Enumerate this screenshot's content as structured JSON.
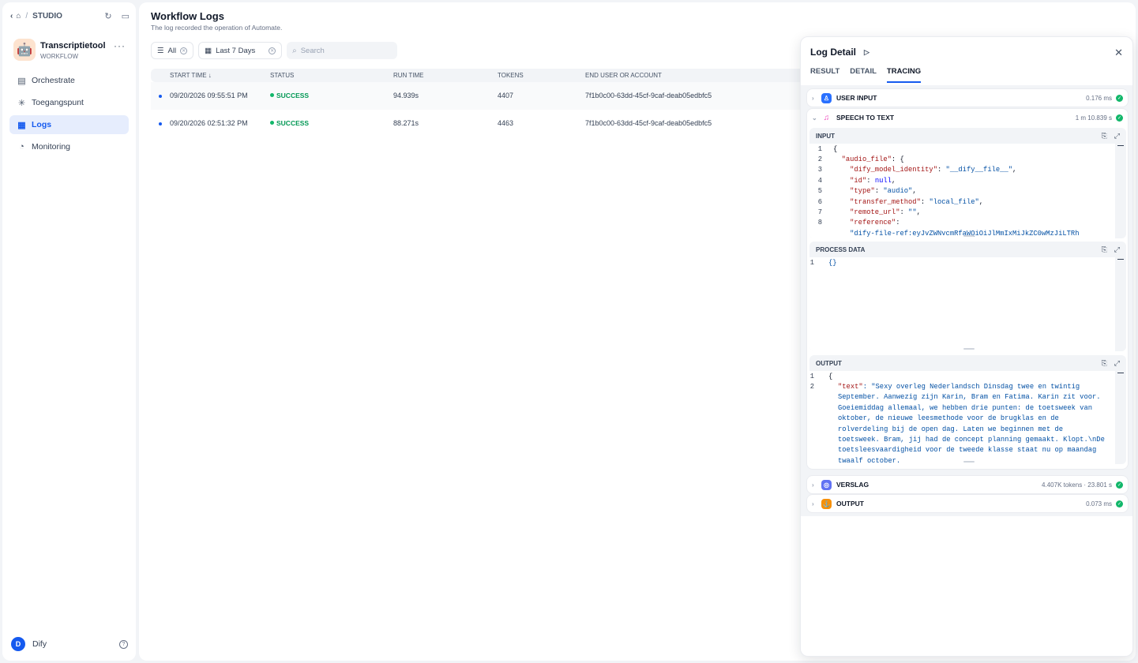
{
  "breadcrumb": {
    "section": "STUDIO"
  },
  "app": {
    "name": "Transcriptietool",
    "type": "WORKFLOW",
    "icon": "robot-icon"
  },
  "nav": [
    {
      "label": "Orchestrate",
      "icon": "orchestrate-icon"
    },
    {
      "label": "Toegangspunt",
      "icon": "access-point-icon"
    },
    {
      "label": "Logs",
      "icon": "logs-icon",
      "active": true
    },
    {
      "label": "Monitoring",
      "icon": "monitoring-icon"
    }
  ],
  "user": {
    "initial": "D",
    "name": "Dify"
  },
  "page": {
    "title": "Workflow Logs",
    "subtitle": "The log recorded the operation of Automate."
  },
  "filters": {
    "status": "All",
    "period": "Last 7 Days",
    "search_placeholder": "Search"
  },
  "table": {
    "headers": [
      "START TIME",
      "STATUS",
      "RUN TIME",
      "TOKENS",
      "END USER OR ACCOUNT"
    ],
    "rows": [
      {
        "start": "09/20/2026 09:55:51 PM",
        "status": "SUCCESS",
        "runtime": "94.939s",
        "tokens": "4407",
        "user": "7f1b0c00-63dd-45cf-9caf-deab05edbfc5"
      },
      {
        "start": "09/20/2026 02:51:32 PM",
        "status": "SUCCESS",
        "runtime": "88.271s",
        "tokens": "4463",
        "user": "7f1b0c00-63dd-45cf-9caf-deab05edbfc5"
      }
    ]
  },
  "detail": {
    "title": "Log Detail",
    "tabs": [
      "RESULT",
      "DETAIL",
      "TRACING"
    ],
    "active_tab": "TRACING",
    "nodes": {
      "user_input": {
        "name": "USER INPUT",
        "meta": "0.176 ms",
        "color": "#2970ff"
      },
      "stt": {
        "name": "SPEECH TO TEXT",
        "meta": "1 m 10.839 s",
        "color": "#ee46bc"
      },
      "verslag": {
        "name": "VERSLAG",
        "meta": "4.407K tokens · 23.801 s",
        "color": "#6172f3"
      },
      "output": {
        "name": "OUTPUT",
        "meta": "0.073 ms",
        "color": "#f79009"
      }
    },
    "input_block": {
      "title": "INPUT",
      "lines": [
        "1",
        "2",
        "3",
        "4",
        "5",
        "6",
        "7",
        "8"
      ],
      "keys": {
        "audio_file": "\"audio_file\"",
        "identity": "\"dify_model_identity\"",
        "id": "\"id\"",
        "type": "\"type\"",
        "method": "\"transfer_method\"",
        "remote": "\"remote_url\"",
        "reference": "\"reference\""
      },
      "values": {
        "identity": "\"__dify__file__\"",
        "id": "null",
        "type": "\"audio\"",
        "method": "\"local_file\"",
        "remote": "\"\"",
        "reference": "\"dify-file-ref:eyJvZWNvcmRfaWQiOiJlMmIxMiJkZC0wMzJiLTRh"
      }
    },
    "process_block": {
      "title": "PROCESS DATA",
      "line": "1",
      "code": "{}"
    },
    "output_block": {
      "title": "OUTPUT",
      "key": "\"text\"",
      "text": "\"Sexy overleg Nederlandsch Dinsdag twee en twintig September. Aanwezig zijn Karin, Bram en Fatima. Karin zit voor. Goeiemiddag allemaal, we hebben drie punten: de toetsweek van oktober, de nieuwe leesmethode voor de brugklas en de rolverdeling bij de open dag. Laten we beginnen met de toetsweek. Bram, jij had de concept planning gemaakt. Klopt.\\nDe toetsleesvaardigheid voor de tweede klasse staat nu op maandag twaalf october."
    }
  }
}
